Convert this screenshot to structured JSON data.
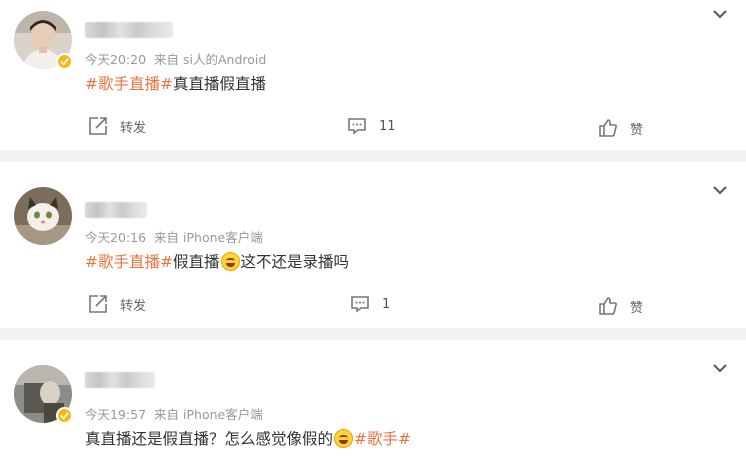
{
  "comments": [
    {
      "time": "今天20:20",
      "source": "来自 si人的Android",
      "tag": "#歌手直播#",
      "text_before": "",
      "text_after": "真直播假直播",
      "actions": {
        "repost_label": "转发",
        "comment_count": "11",
        "like_label": "赞"
      }
    },
    {
      "time": "今天20:16",
      "source": "来自 iPhone客户端",
      "tag": "#歌手直播#",
      "text_before": "",
      "text_middle": "假直播",
      "text_after": "这不还是录播吗",
      "actions": {
        "repost_label": "转发",
        "comment_count": "1",
        "like_label": "赞"
      }
    },
    {
      "time": "今天19:57",
      "source": "来自 iPhone客户端",
      "text_before": "真直播还是假直播？怎么感觉像假的",
      "tag": "#歌手#"
    }
  ],
  "icons": {
    "more": "chevron-down-icon",
    "repost": "share-icon",
    "comment": "comment-icon",
    "like": "thumbs-up-icon",
    "verified": "verified-badge-icon"
  },
  "colors": {
    "tag": "#eb7340",
    "badge": "#f6b814",
    "separator": "#f2f2f2"
  }
}
